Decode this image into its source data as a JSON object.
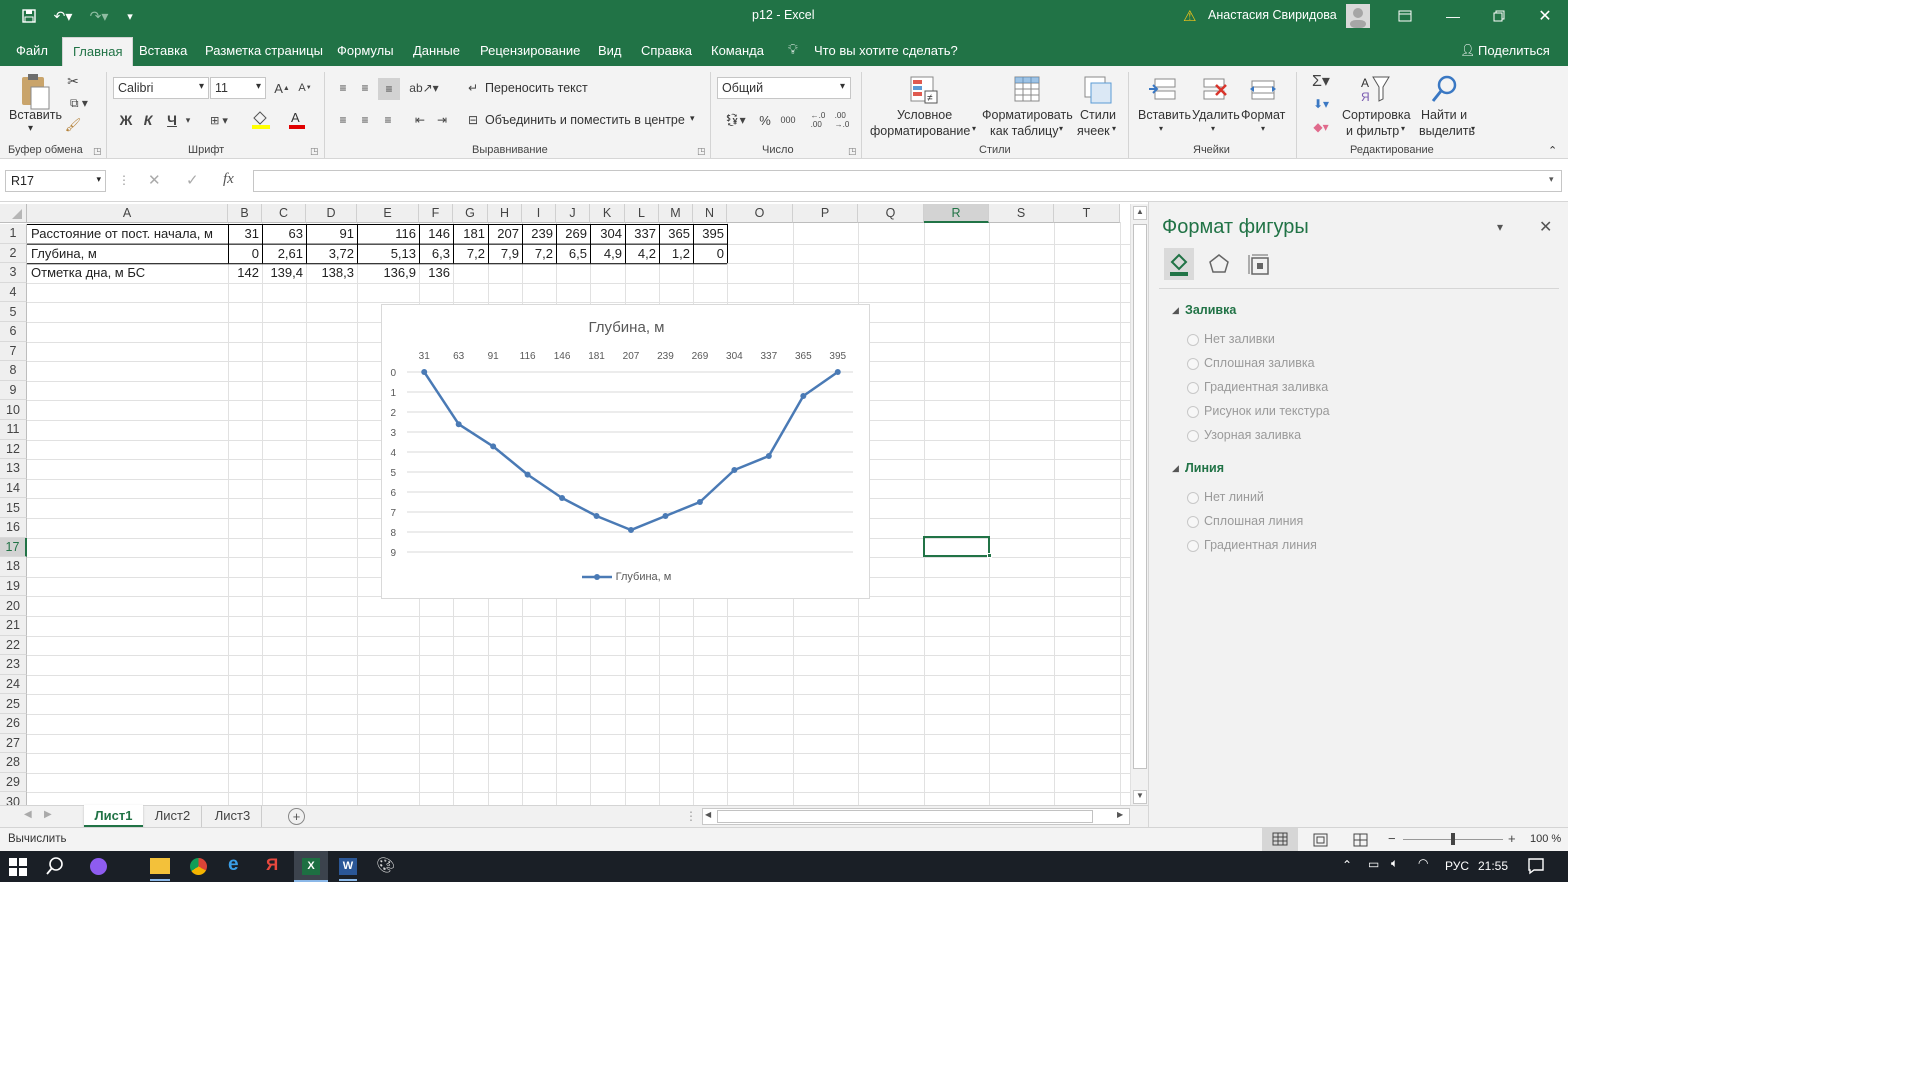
{
  "window": {
    "title": "p12  -  Excel",
    "user": "Анастасия Свиридова"
  },
  "tabs": [
    "Файл",
    "Главная",
    "Вставка",
    "Разметка страницы",
    "Формулы",
    "Данные",
    "Рецензирование",
    "Вид",
    "Справка",
    "Команда"
  ],
  "tell_me": "Что вы хотите сделать?",
  "share": "Поделиться",
  "ribbon": {
    "clipboard": {
      "paste": "Вставить",
      "label": "Буфер обмена"
    },
    "font": {
      "name": "Calibri",
      "size": "11",
      "bold": "Ж",
      "italic": "К",
      "underline": "Ч",
      "label": "Шрифт"
    },
    "alignment": {
      "wrap": "Переносить текст",
      "merge": "Объединить и поместить в центре",
      "label": "Выравнивание"
    },
    "number": {
      "format": "Общий",
      "percent": "%",
      "thousands": "000",
      "label": "Число"
    },
    "styles": {
      "conditional_1": "Условное",
      "conditional_2": "форматирование",
      "table_1": "Форматировать",
      "table_2": "как таблицу",
      "cell_1": "Стили",
      "cell_2": "ячеек",
      "label": "Стили"
    },
    "cells": {
      "insert": "Вставить",
      "delete": "Удалить",
      "format": "Формат",
      "label": "Ячейки"
    },
    "editing": {
      "sort_1": "Сортировка",
      "sort_2": "и фильтр",
      "find_1": "Найти и",
      "find_2": "выделить",
      "label": "Редактирование"
    }
  },
  "formula_bar": {
    "name_box": "R17",
    "fx": "fx",
    "value": ""
  },
  "columns": [
    "A",
    "B",
    "C",
    "D",
    "E",
    "F",
    "G",
    "H",
    "I",
    "J",
    "K",
    "L",
    "M",
    "N",
    "O",
    "P",
    "Q",
    "R",
    "S",
    "T"
  ],
  "rows": [
    "1",
    "2",
    "3",
    "4",
    "5",
    "6",
    "7",
    "8",
    "9",
    "10",
    "11",
    "12",
    "13",
    "14",
    "15",
    "16",
    "17",
    "18",
    "19",
    "20",
    "21",
    "22",
    "23",
    "24",
    "25",
    "26",
    "27",
    "28",
    "29",
    "30"
  ],
  "sheet_rows": [
    {
      "label": "Расстояние от пост. начала, м",
      "values": [
        "31",
        "63",
        "91",
        "116",
        "146",
        "181",
        "207",
        "239",
        "269",
        "304",
        "337",
        "365",
        "395"
      ]
    },
    {
      "label": "Глубина, м",
      "values": [
        "0",
        "2,61",
        "3,72",
        "5,13",
        "6,3",
        "7,2",
        "7,9",
        "7,2",
        "6,5",
        "4,9",
        "4,2",
        "1,2",
        "0"
      ]
    },
    {
      "label": "Отметка дна, м БС",
      "values": [
        "142",
        "139,4",
        "138,3",
        "136,9",
        "136"
      ]
    }
  ],
  "chart_data": {
    "type": "line",
    "title": "Глубина, м",
    "categories": [
      "31",
      "63",
      "91",
      "116",
      "146",
      "181",
      "207",
      "239",
      "269",
      "304",
      "337",
      "365",
      "395"
    ],
    "series": [
      {
        "name": "Глубина, м",
        "values": [
          0,
          2.61,
          3.72,
          5.13,
          6.3,
          7.2,
          7.9,
          7.2,
          6.5,
          4.9,
          4.2,
          1.2,
          0
        ],
        "color": "#4a7ab5"
      }
    ],
    "y_ticks": [
      "0",
      "1",
      "2",
      "3",
      "4",
      "5",
      "6",
      "7",
      "8",
      "9"
    ],
    "ylim": [
      0,
      9
    ],
    "y_reversed": true,
    "x_axis_position": "top",
    "grid": true,
    "legend": "bottom"
  },
  "panel": {
    "title": "Формат фигуры",
    "fill_header": "Заливка",
    "fill_options": [
      "Нет заливки",
      "Сплошная заливка",
      "Градиентная заливка",
      "Рисунок или текстура",
      "Узорная заливка"
    ],
    "line_header": "Линия",
    "line_options": [
      "Нет линий",
      "Сплошная линия",
      "Градиентная линия"
    ]
  },
  "sheets": [
    "Лист1",
    "Лист2",
    "Лист3"
  ],
  "status": {
    "mode": "Вычислить",
    "zoom": "100 %"
  },
  "taskbar": {
    "lang": "РУС",
    "time": "21:55"
  }
}
